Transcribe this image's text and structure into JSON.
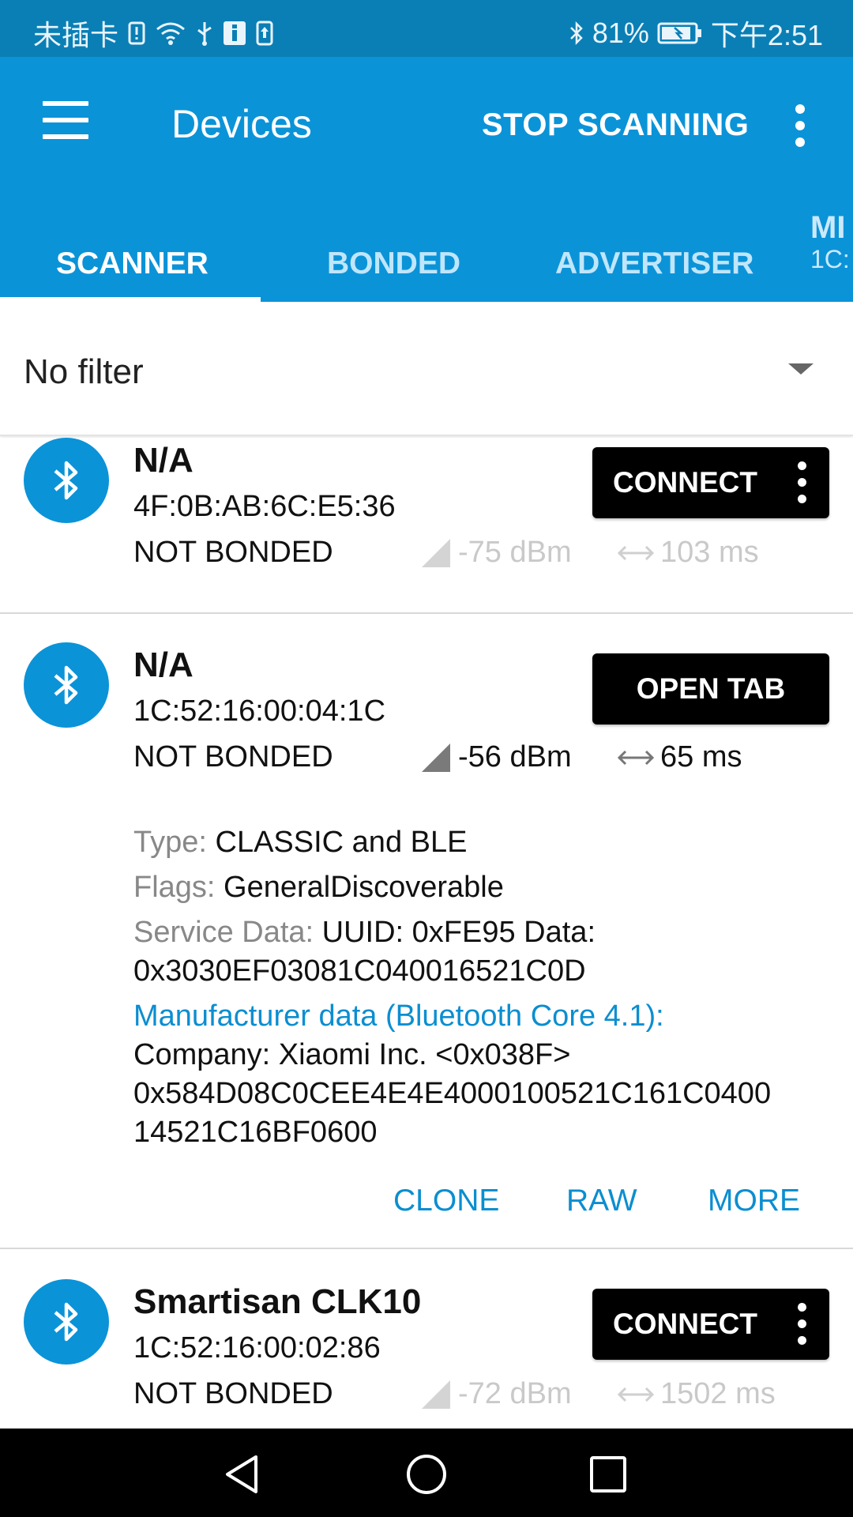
{
  "status_bar": {
    "carrier": "未插卡",
    "battery": "81%",
    "time": "下午2:51"
  },
  "app_bar": {
    "title": "Devices",
    "action": "STOP SCANNING",
    "tabs": [
      {
        "label": "SCANNER",
        "active": true
      },
      {
        "label": "BONDED",
        "active": false
      },
      {
        "label": "ADVERTISER",
        "active": false
      }
    ],
    "partial_tab": {
      "label": "MI",
      "sub": "1C:"
    }
  },
  "filter": {
    "value": "No filter"
  },
  "devices": [
    {
      "name": "N/A",
      "address": "4F:0B:AB:6C:E5:36",
      "bond": "NOT BONDED",
      "rssi": "-75 dBm",
      "interval": "103 ms",
      "button": "CONNECT"
    },
    {
      "name": "N/A",
      "address": "1C:52:16:00:04:1C",
      "bond": "NOT BONDED",
      "rssi": "-56 dBm",
      "interval": "65 ms",
      "button": "OPEN TAB",
      "details": {
        "type_label": "Type: ",
        "type_value": "CLASSIC and BLE",
        "flags_label": "Flags: ",
        "flags_value": "GeneralDiscoverable",
        "service_label": "Service Data: ",
        "service_value_1": "UUID: 0xFE95 Data:",
        "service_value_2": "0x3030EF03081C040016521C0D",
        "manufacturer_label": "Manufacturer data (Bluetooth Core 4.1):",
        "manufacturer_company": "Company: Xiaomi Inc. <0x038F>",
        "manufacturer_data_1": "0x584D08C0CEE4E4E4000100521C161C0400",
        "manufacturer_data_2": "14521C16BF0600"
      },
      "actions": [
        "CLONE",
        "RAW",
        "MORE"
      ]
    },
    {
      "name": "Smartisan CLK10",
      "address": "1C:52:16:00:02:86",
      "bond": "NOT BONDED",
      "rssi": "-72 dBm",
      "interval": "1502 ms",
      "button": "CONNECT"
    }
  ],
  "colors": {
    "status_bar": "#0a7fb5",
    "app_bar": "#0b93d8",
    "accent": "#0b8ed0"
  },
  "icons": [
    "menu-icon",
    "overflow-icon",
    "bluetooth-icon",
    "signal-icon",
    "interval-icon",
    "back-icon",
    "home-icon",
    "recents-icon"
  ]
}
